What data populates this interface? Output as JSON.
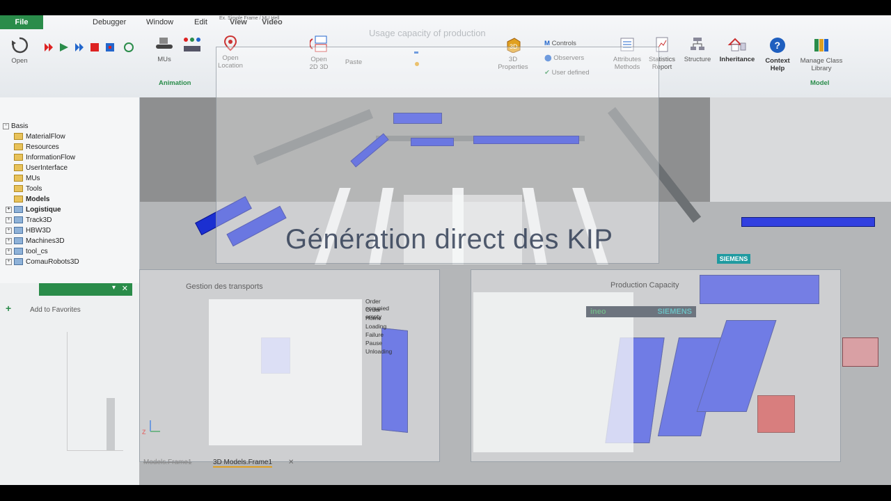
{
  "ribbon": {
    "file_tab": "File",
    "menu_tabs": [
      "Debugger",
      "Window",
      "Edit",
      "View",
      "Video"
    ],
    "window_title": "Ex. Simple Frame / MU Hell",
    "chart_title": "Usage capacity of production",
    "buttons": {
      "open": "Open",
      "mus": "MUs",
      "open_location": "Open Location",
      "open_2d3d": "Open 2D 3D",
      "paste": "Paste",
      "properties_3d": "3D Properties",
      "controls": "Controls",
      "observers": "Observers",
      "user_defined": "User defined",
      "attributes_methods": "Attributes Methods",
      "statistics_report": "Statistics Report",
      "structure": "Structure",
      "inheritance": "Inheritance",
      "context_help": "Context Help",
      "manage_class_library": "Manage Class Library"
    },
    "groups": {
      "animation": "Animation",
      "model": "Model"
    }
  },
  "tree": {
    "items": [
      {
        "label": "Basis",
        "type": "root"
      },
      {
        "label": "MaterialFlow",
        "type": "folder"
      },
      {
        "label": "Resources",
        "type": "folder"
      },
      {
        "label": "InformationFlow",
        "type": "folder"
      },
      {
        "label": "UserInterface",
        "type": "folder"
      },
      {
        "label": "MUs",
        "type": "folder"
      },
      {
        "label": "Tools",
        "type": "folder"
      },
      {
        "label": "Models",
        "type": "folder"
      },
      {
        "label": "Logistique",
        "type": "lib"
      },
      {
        "label": "Track3D",
        "type": "lib"
      },
      {
        "label": "HBW3D",
        "type": "lib"
      },
      {
        "label": "Machines3D",
        "type": "lib"
      },
      {
        "label": "tool_cs",
        "type": "lib"
      },
      {
        "label": "ComauRobots3D",
        "type": "lib"
      }
    ]
  },
  "favorites": {
    "add_label": "Add to Favorites"
  },
  "overlays": {
    "kpi_caption": "Génération direct des KIP",
    "transports_title": "Gestion des transports",
    "production_title": "Production Capacity",
    "legend": [
      "Order occupied",
      "Order empty",
      "Home",
      "Loading",
      "Failure",
      "Pause",
      "Unloading"
    ]
  },
  "viewport": {
    "brand_ineo": "ineo",
    "brand_siemens": "SIEMENS",
    "axis_z": "Z"
  },
  "bottom_tabs": [
    "Models.Frame1",
    "3D Models.Frame1"
  ],
  "colors": {
    "accent_green": "#2a8c4a",
    "rack_blue": "#1b2fd1",
    "siemens_teal": "#1f9aa0"
  }
}
